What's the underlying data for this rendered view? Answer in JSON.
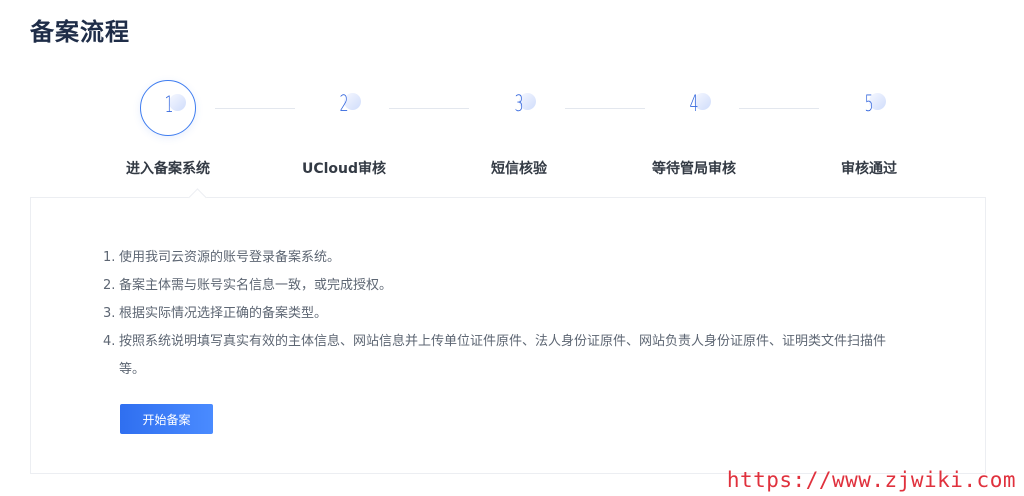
{
  "page": {
    "title": "备案流程"
  },
  "steps": [
    {
      "number": "1",
      "label": "进入备案系统",
      "active": true
    },
    {
      "number": "2",
      "label": "UCloud审核",
      "active": false
    },
    {
      "number": "3",
      "label": "短信核验",
      "active": false
    },
    {
      "number": "4",
      "label": "等待管局审核",
      "active": false
    },
    {
      "number": "5",
      "label": "审核通过",
      "active": false
    }
  ],
  "instructions": [
    {
      "num": "1.",
      "text": "使用我司云资源的账号登录备案系统。"
    },
    {
      "num": "2.",
      "text": "备案主体需与账号实名信息一致，或完成授权。"
    },
    {
      "num": "3.",
      "text": "根据实际情况选择正确的备案类型。"
    },
    {
      "num": "4.",
      "text": "按照系统说明填写真实有效的主体信息、网站信息并上传单位证件原件、法人身份证原件、网站负责人身份证原件、证明类文件扫描件等。"
    }
  ],
  "actions": {
    "start_label": "开始备案"
  },
  "watermark": {
    "text": "https://www.zjwiki.com"
  },
  "colors": {
    "accent": "#3f7df0",
    "title": "#1f2d48",
    "watermark": "#e0313d"
  }
}
